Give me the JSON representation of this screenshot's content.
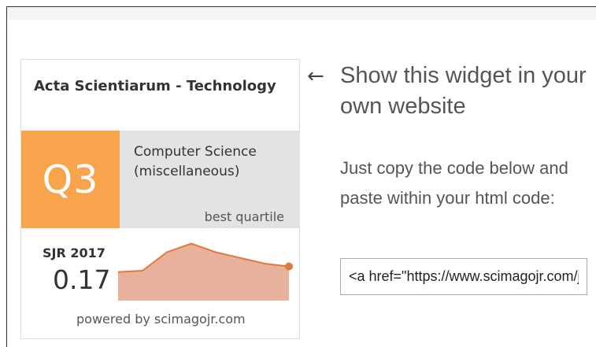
{
  "widget": {
    "journal_title": "Acta Scientiarum - Technology",
    "quartile": "Q3",
    "category": "Computer Science (miscellaneous)",
    "quartile_caption": "best quartile",
    "sjr_label": "SJR 2017",
    "sjr_value": "0.17",
    "powered_by": "powered by scimagojr.com",
    "colors": {
      "quartile_bg": "#f8a44c",
      "category_bg": "#e3e3e3",
      "trend_line": "#e0793f",
      "trend_fill": "#e8b19b"
    },
    "trend_values": [
      0.15,
      0.155,
      0.22,
      0.25,
      0.22,
      0.2,
      0.18,
      0.17
    ]
  },
  "promo": {
    "arrow": "←",
    "title": "Show this widget in your own website",
    "text": "Just copy the code below and paste within your html code:",
    "code_value": "<a href=\"https://www.scimagojr.com/journalsearch.php?q=\" title=\"SCImago Journal &amp; Country Rank\">"
  }
}
